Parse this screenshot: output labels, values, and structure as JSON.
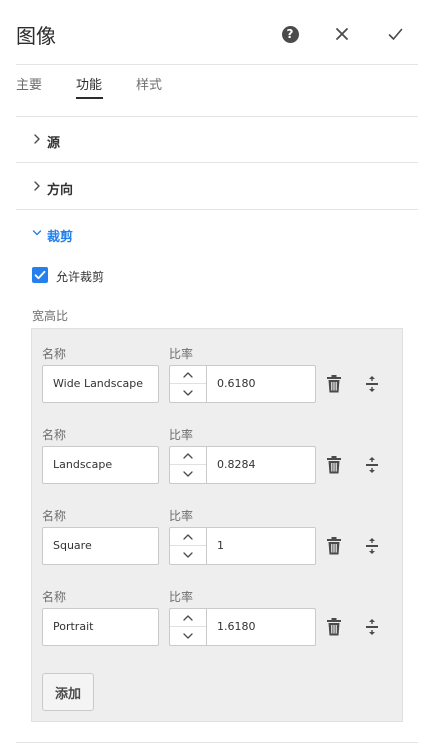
{
  "dialog": {
    "title": "图像",
    "help_icon": "help-icon",
    "close_icon": "close-icon",
    "confirm_icon": "checkmark-icon"
  },
  "tabs": [
    {
      "label": "主要",
      "active": false
    },
    {
      "label": "功能",
      "active": true
    },
    {
      "label": "样式",
      "active": false
    }
  ],
  "sections": {
    "source": {
      "label": "源",
      "expanded": false
    },
    "orientation": {
      "label": "方向",
      "expanded": false
    },
    "crop": {
      "label": "裁剪",
      "expanded": true
    }
  },
  "crop": {
    "allow_crop_label": "允许裁剪",
    "allow_crop_checked": true,
    "aspect_ratio_label": "宽高比",
    "name_label": "名称",
    "ratio_label": "比率",
    "add_label": "添加",
    "rows": [
      {
        "name": "Wide Landscape",
        "ratio": "0.6180"
      },
      {
        "name": "Landscape",
        "ratio": "0.8284"
      },
      {
        "name": "Square",
        "ratio": "1"
      },
      {
        "name": "Portrait",
        "ratio": "1.6180"
      }
    ]
  },
  "colors": {
    "accent": "#2680eb",
    "text": "#323232",
    "panel_bg": "#eeeeee"
  }
}
